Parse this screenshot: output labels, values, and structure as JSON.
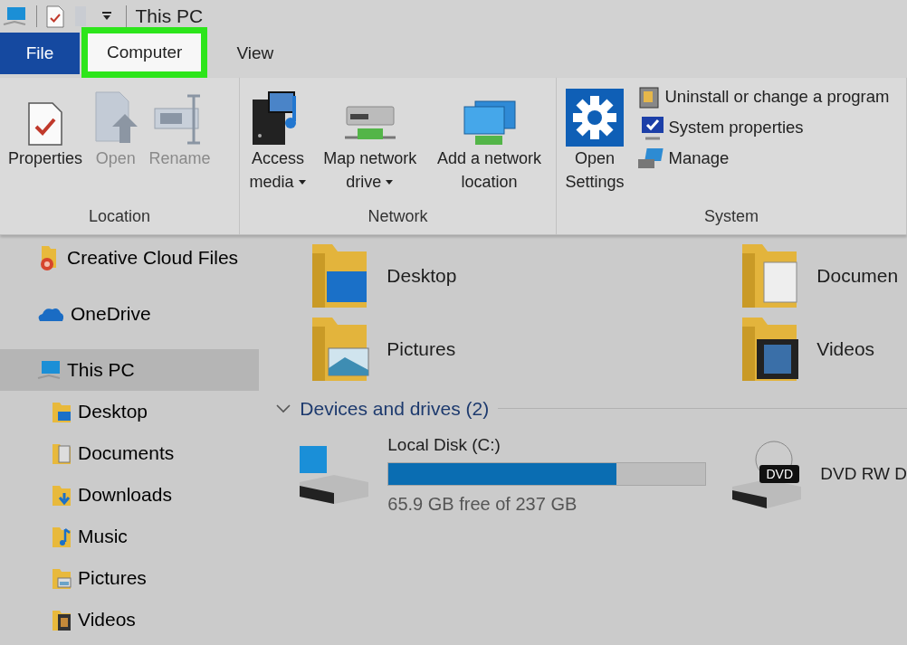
{
  "title_bar": {
    "title": "This PC"
  },
  "tabs": [
    {
      "label": "File",
      "kind": "file",
      "selected": false,
      "highlighted": false
    },
    {
      "label": "Computer",
      "kind": "tab",
      "selected": true,
      "highlighted": true
    },
    {
      "label": "View",
      "kind": "tab",
      "selected": false,
      "highlighted": false
    }
  ],
  "ribbon": [
    {
      "label": "Location",
      "buttons": [
        {
          "label": "Properties",
          "disabled": false,
          "dropdown": false
        },
        {
          "label": "Open",
          "disabled": true,
          "dropdown": false
        },
        {
          "label": "Rename",
          "disabled": true,
          "dropdown": false
        }
      ]
    },
    {
      "label": "Network",
      "buttons": [
        {
          "label": "Access media",
          "disabled": false,
          "dropdown": true
        },
        {
          "label": "Map network drive",
          "disabled": false,
          "dropdown": true
        },
        {
          "label": "Add a network location",
          "disabled": false,
          "dropdown": false
        }
      ]
    },
    {
      "label": "System",
      "buttons": [
        {
          "label": "Open Settings",
          "disabled": false,
          "dropdown": false
        }
      ],
      "small_buttons": [
        "Uninstall or change a program",
        "System properties",
        "Manage"
      ]
    }
  ],
  "sidebar": {
    "items": [
      {
        "label": "Creative Cloud Files",
        "selected": false
      },
      {
        "label": "OneDrive",
        "selected": false
      },
      {
        "label": "This PC",
        "selected": true,
        "children": [
          {
            "label": "Desktop",
            "selected": false
          },
          {
            "label": "Documents",
            "selected": false
          },
          {
            "label": "Downloads",
            "selected": false
          },
          {
            "label": "Music",
            "selected": false
          },
          {
            "label": "Pictures",
            "selected": false
          },
          {
            "label": "Videos",
            "selected": false
          }
        ]
      }
    ]
  },
  "folders": [
    {
      "label": "Desktop"
    },
    {
      "label": "Documen"
    },
    {
      "label": "Pictures"
    },
    {
      "label": "Videos"
    }
  ],
  "devices": {
    "header": "Devices and drives (2)",
    "expanded": true,
    "drives": [
      {
        "kind": "disk",
        "label": "Local Disk (C:)",
        "level": 0.72,
        "caption": "65.9 GB free of 237 GB"
      },
      {
        "kind": "dvd",
        "badge": "DVD",
        "label": "DVD RW D"
      }
    ]
  }
}
